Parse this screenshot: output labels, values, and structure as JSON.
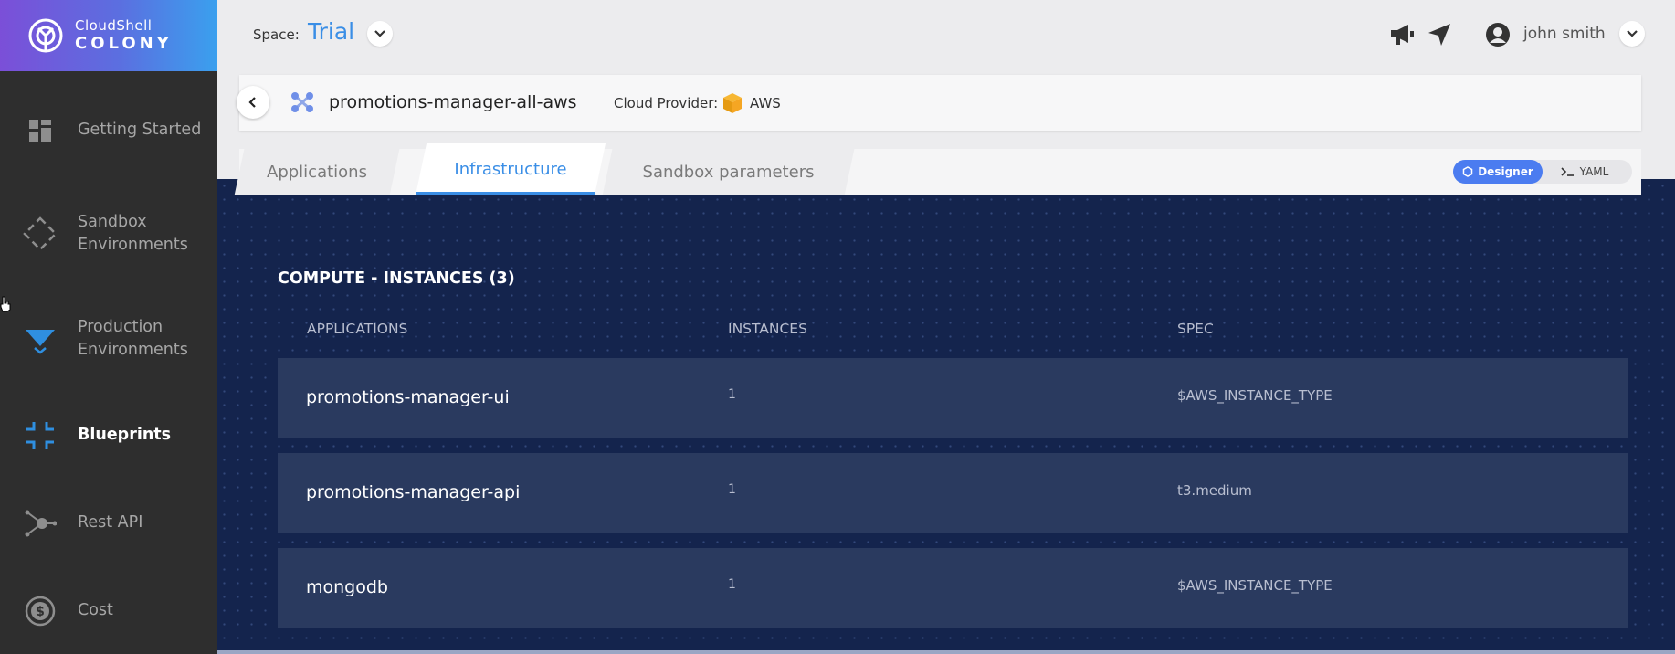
{
  "brand": {
    "top": "CloudShell",
    "bottom": "COLONY"
  },
  "sidebar": {
    "items": [
      {
        "label": "Getting Started",
        "icon": "dashboard-icon"
      },
      {
        "label": "Sandbox Environments",
        "icon": "sandbox-icon"
      },
      {
        "label": "Production Environments",
        "icon": "production-icon"
      },
      {
        "label": "Blueprints",
        "icon": "blueprints-icon",
        "active": true
      },
      {
        "label": "Rest API",
        "icon": "rest-api-icon"
      },
      {
        "label": "Cost",
        "icon": "cost-icon"
      }
    ]
  },
  "topbar": {
    "space_label": "Space:",
    "space_value": "Trial",
    "user_name": "john smith"
  },
  "blueprint": {
    "name": "promotions-manager-all-aws",
    "cloud_provider_label": "Cloud Provider:",
    "cloud_provider_value": "AWS"
  },
  "tabs": [
    {
      "label": "Applications"
    },
    {
      "label": "Infrastructure",
      "active": true
    },
    {
      "label": "Sandbox parameters"
    }
  ],
  "view_toggle": {
    "designer": "Designer",
    "yaml": "YAML"
  },
  "compute": {
    "title": "COMPUTE - INSTANCES (3)",
    "columns": [
      "APPLICATIONS",
      "INSTANCES",
      "SPEC"
    ],
    "rows": [
      {
        "app": "promotions-manager-ui",
        "instances": "1",
        "spec": "$AWS_INSTANCE_TYPE"
      },
      {
        "app": "promotions-manager-api",
        "instances": "1",
        "spec": "t3.medium"
      },
      {
        "app": "mongodb",
        "instances": "1",
        "spec": "$AWS_INSTANCE_TYPE"
      }
    ]
  },
  "colors": {
    "accent": "#3a8ee6",
    "sidebar_bg": "#2e2e2e",
    "canvas_bg": "#14244d",
    "row_bg": "#2a3a5f"
  }
}
